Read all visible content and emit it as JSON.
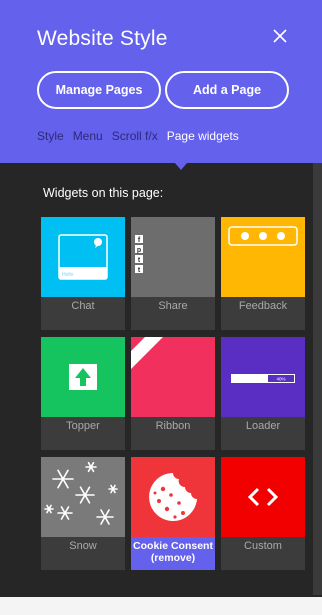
{
  "header": {
    "title": "Website Style",
    "buttons": {
      "manage_pages": "Manage Pages",
      "add_page": "Add a Page"
    },
    "tabs": [
      {
        "label": "Style"
      },
      {
        "label": "Menu"
      },
      {
        "label": "Scroll f/x"
      },
      {
        "label": "Page widgets",
        "active": true
      }
    ]
  },
  "widgets_title": "Widgets on this page:",
  "widgets": [
    {
      "label": "Chat",
      "icon": "chat-window-icon",
      "color": "#00c0f3",
      "chat_placeholder": "Hello"
    },
    {
      "label": "Share",
      "icon": "share-icons",
      "color": "#6d6d6d",
      "glyphs": [
        "f",
        "p",
        "t",
        "t"
      ]
    },
    {
      "label": "Feedback",
      "icon": "feedback-dots-icon",
      "color": "#ffb703"
    },
    {
      "label": "Topper",
      "icon": "arrow-up-icon",
      "color": "#16c45f"
    },
    {
      "label": "Ribbon",
      "icon": "corner-ribbon-icon",
      "color": "#f2305e"
    },
    {
      "label": "Loader",
      "icon": "progress-bar-icon",
      "color": "#5a2ec2",
      "progress": "40%"
    },
    {
      "label": "Snow",
      "icon": "snowflake-icon",
      "color": "#7a7a7a"
    },
    {
      "label": "Cookie Consent",
      "icon": "cookie-icon",
      "color": "#f0353a",
      "selected": true,
      "remove": "(remove)"
    },
    {
      "label": "Custom",
      "icon": "code-brackets-icon",
      "color": "#f20000"
    }
  ]
}
